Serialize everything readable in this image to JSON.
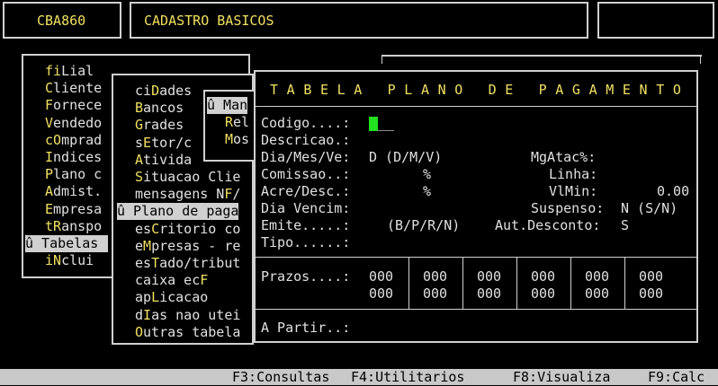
{
  "header": {
    "program_code": "CBA860",
    "title": "CADASTRO BASICOS"
  },
  "main_menu": [
    {
      "hot": "fi",
      "rest": "Lial",
      "full": "fiLial"
    },
    {
      "hot": "C",
      "rest": "liente",
      "full": "Cliente"
    },
    {
      "hot": "F",
      "rest": "ornece",
      "full": "Fornece"
    },
    {
      "hot": "V",
      "rest": "endedo",
      "full": "Vendedo"
    },
    {
      "hot": "cO",
      "rest": "mprad",
      "full": "cOmprad"
    },
    {
      "hot": "I",
      "rest": "ndices",
      "full": "Indices"
    },
    {
      "hot": "P",
      "rest": "lano c",
      "full": "Plano c"
    },
    {
      "hot": "A",
      "rest": "dmist.",
      "full": "Admist."
    },
    {
      "hot": "E",
      "rest": "mpresa",
      "full": "Empresa"
    },
    {
      "hot": "tR",
      "rest": "anspo",
      "full": "tRanspo"
    },
    {
      "hot": "",
      "rest": "û Tabelas",
      "full": "û Tabelas"
    },
    {
      "hot": "iN",
      "rest": "clui",
      "full": "iNclui"
    }
  ],
  "submenu": [
    "ciDades",
    "Bancos",
    "Grades",
    "sEtor/c",
    "Ativida",
    "Situacao Clie",
    "mensagens NF/",
    "û Plano de paga",
    "esCritorio co",
    "eMpresas - re",
    "esTado/tribut",
    "caixa ecF",
    "apLicacao",
    "dIas nao utei",
    "Outras tabela"
  ],
  "submenu3": [
    "û Man",
    "Rel",
    "Mos"
  ],
  "form": {
    "title": "T A B E L A   P L A N O   D E   P A G A M E N T O",
    "codigo_label": "Codigo....:",
    "codigo_value": "__",
    "descricao_label": "Descricao.:",
    "dia_label": "Dia/Mes/Ve:",
    "dia_value": "D (D/M/V)",
    "mgatac_label": "MgAtac%:",
    "comissao_label": "Comissao..:",
    "comissao_value": "%",
    "linha_label": "Linha:",
    "acre_label": "Acre/Desc.:",
    "acre_value": "%",
    "vlmin_label": "VlMin:",
    "vlmin_value": "0.00",
    "diavenc_label": "Dia Vencim:",
    "suspenso_label": "Suspenso:",
    "suspenso_value": "N (S/N)",
    "emite_label": "Emite.....:",
    "emite_value": "(B/P/R/N)",
    "autdesc_label": "Aut.Desconto:",
    "autdesc_value": "S",
    "tipo_label": "Tipo......:",
    "prazos_label": "Prazos....:",
    "prazos_row1": [
      "000",
      "000",
      "000",
      "000",
      "000",
      "000"
    ],
    "prazos_row2": [
      "000",
      "000",
      "000",
      "000",
      "000",
      "000"
    ],
    "apartir_label": "A Partir..:"
  },
  "statusbar": {
    "f3": "F3:Consultas",
    "f4": "F4:Utilitarios",
    "f8": "F8:Visualiza",
    "f9": "F9:Calc"
  }
}
